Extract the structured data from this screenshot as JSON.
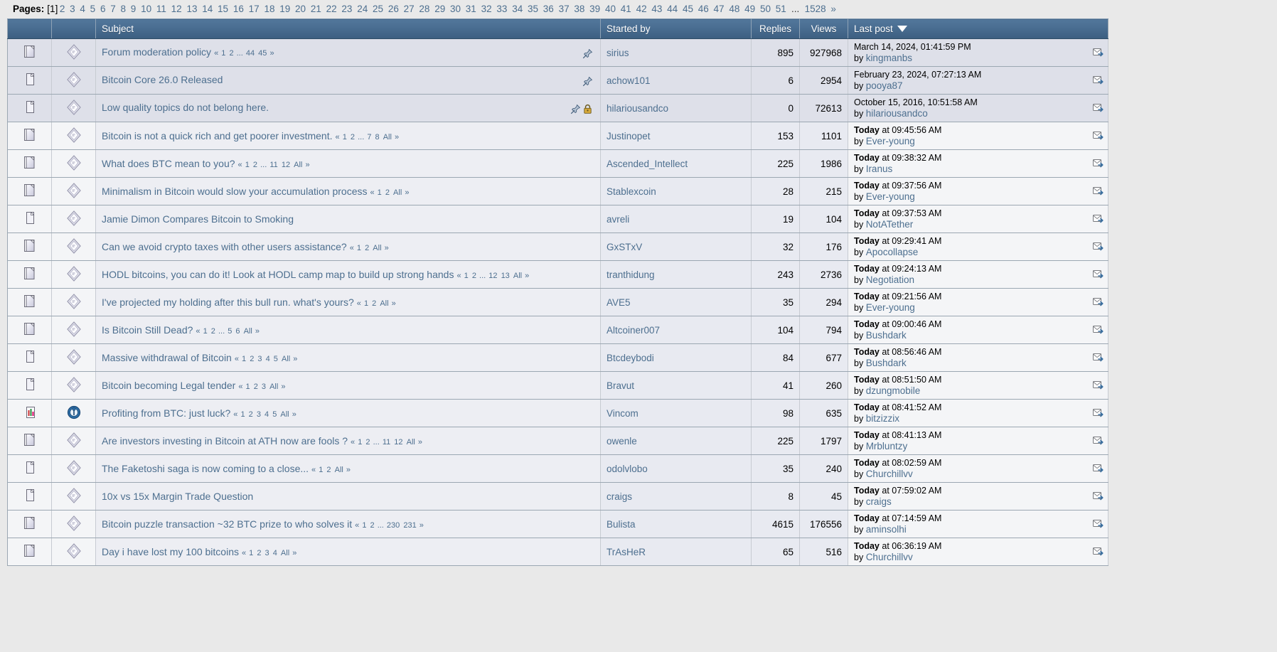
{
  "pagination": {
    "label": "Pages:",
    "current": "1",
    "pages": [
      "2",
      "3",
      "4",
      "5",
      "6",
      "7",
      "8",
      "9",
      "10",
      "11",
      "12",
      "13",
      "14",
      "15",
      "16",
      "17",
      "18",
      "19",
      "20",
      "21",
      "22",
      "23",
      "24",
      "25",
      "26",
      "27",
      "28",
      "29",
      "30",
      "31",
      "32",
      "33",
      "34",
      "35",
      "36",
      "37",
      "38",
      "39",
      "40",
      "41",
      "42",
      "43",
      "44",
      "45",
      "46",
      "47",
      "48",
      "49",
      "50",
      "51"
    ],
    "ellipsis": "...",
    "last": "1528",
    "next": "»"
  },
  "columns": {
    "icon1": "",
    "icon2": "",
    "subject": "Subject",
    "started_by": "Started by",
    "replies": "Replies",
    "views": "Views",
    "last_post": "Last post",
    "sort_indicator": "descending"
  },
  "rows": [
    {
      "state": "sticky",
      "icon1": "pages-stack-icon",
      "icon2": "topic-hot-icon",
      "subject": "Forum moderation policy",
      "pages": [
        "1",
        "2",
        "...",
        "44",
        "45"
      ],
      "has_all": false,
      "pinned": true,
      "locked": false,
      "started_by": "sirius",
      "replies": "895",
      "views": "927968",
      "last_post_date": "March 14, 2024, 01:41:59 PM",
      "last_post_today": false,
      "last_post_by": "kingmanbs"
    },
    {
      "state": "sticky",
      "icon1": "page-single-icon",
      "icon2": "topic-hot-icon",
      "subject": "Bitcoin Core 26.0 Released",
      "pages": [],
      "has_all": false,
      "pinned": true,
      "locked": false,
      "started_by": "achow101",
      "replies": "6",
      "views": "2954",
      "last_post_date": "February 23, 2024, 07:27:13 AM",
      "last_post_today": false,
      "last_post_by": "pooya87"
    },
    {
      "state": "sticky",
      "icon1": "page-single-icon",
      "icon2": "topic-hot-icon",
      "subject": "Low quality topics do not belong here.",
      "pages": [],
      "has_all": false,
      "pinned": true,
      "locked": true,
      "started_by": "hilariousandco",
      "replies": "0",
      "views": "72613",
      "last_post_date": "October 15, 2016, 10:51:58 AM",
      "last_post_today": false,
      "last_post_by": "hilariousandco"
    },
    {
      "state": "normal",
      "icon1": "pages-stack-icon",
      "icon2": "topic-hot-icon",
      "subject": "Bitcoin is not a quick rich and get poorer investment.",
      "pages": [
        "1",
        "2",
        "...",
        "7",
        "8"
      ],
      "has_all": true,
      "pinned": false,
      "locked": false,
      "started_by": "Justinopet",
      "replies": "153",
      "views": "1101",
      "last_post_date": "at 09:45:56 AM",
      "last_post_today": true,
      "last_post_by": "Ever-young"
    },
    {
      "state": "normal",
      "icon1": "pages-stack-icon",
      "icon2": "topic-hot-icon",
      "subject": "What does BTC mean to you?",
      "pages": [
        "1",
        "2",
        "...",
        "11",
        "12"
      ],
      "has_all": true,
      "pinned": false,
      "locked": false,
      "started_by": "Ascended_Intellect",
      "replies": "225",
      "views": "1986",
      "last_post_date": "at 09:38:32 AM",
      "last_post_today": true,
      "last_post_by": "Iranus"
    },
    {
      "state": "normal",
      "icon1": "pages-stack-icon",
      "icon2": "topic-hot-icon",
      "subject": "Minimalism in Bitcoin would slow your accumulation process",
      "pages": [
        "1",
        "2"
      ],
      "has_all": true,
      "pinned": false,
      "locked": false,
      "started_by": "Stablexcoin",
      "replies": "28",
      "views": "215",
      "last_post_date": "at 09:37:56 AM",
      "last_post_today": true,
      "last_post_by": "Ever-young"
    },
    {
      "state": "normal",
      "icon1": "page-single-icon",
      "icon2": "topic-hot-icon",
      "subject": "Jamie Dimon Compares Bitcoin to Smoking",
      "pages": [],
      "has_all": false,
      "pinned": false,
      "locked": false,
      "started_by": "avreli",
      "replies": "19",
      "views": "104",
      "last_post_date": "at 09:37:53 AM",
      "last_post_today": true,
      "last_post_by": "NotATether"
    },
    {
      "state": "normal",
      "icon1": "pages-stack-icon",
      "icon2": "topic-hot-icon",
      "subject": "Can we avoid crypto taxes with other users assistance?",
      "pages": [
        "1",
        "2"
      ],
      "has_all": true,
      "pinned": false,
      "locked": false,
      "started_by": "GxSTxV",
      "replies": "32",
      "views": "176",
      "last_post_date": "at 09:29:41 AM",
      "last_post_today": true,
      "last_post_by": "Apocollapse"
    },
    {
      "state": "normal",
      "icon1": "pages-stack-icon",
      "icon2": "topic-hot-icon",
      "subject": "HODL bitcoins, you can do it! Look at HODL camp map to build up strong hands",
      "pages": [
        "1",
        "2",
        "...",
        "12",
        "13"
      ],
      "has_all": true,
      "pinned": false,
      "locked": false,
      "started_by": "tranthidung",
      "replies": "243",
      "views": "2736",
      "last_post_date": "at 09:24:13 AM",
      "last_post_today": true,
      "last_post_by": "Negotiation"
    },
    {
      "state": "normal",
      "icon1": "pages-stack-icon",
      "icon2": "topic-hot-icon",
      "subject": "I've projected my holding after this bull run. what's yours?",
      "pages": [
        "1",
        "2"
      ],
      "has_all": true,
      "pinned": false,
      "locked": false,
      "started_by": "AVE5",
      "replies": "35",
      "views": "294",
      "last_post_date": "at 09:21:56 AM",
      "last_post_today": true,
      "last_post_by": "Ever-young"
    },
    {
      "state": "normal",
      "icon1": "pages-stack-icon",
      "icon2": "topic-hot-icon",
      "subject": "Is Bitcoin Still Dead?",
      "pages": [
        "1",
        "2",
        "...",
        "5",
        "6"
      ],
      "has_all": true,
      "pinned": false,
      "locked": false,
      "started_by": "Altcoiner007",
      "replies": "104",
      "views": "794",
      "last_post_date": "at 09:00:46 AM",
      "last_post_today": true,
      "last_post_by": "Bushdark"
    },
    {
      "state": "normal",
      "icon1": "page-single-icon",
      "icon2": "topic-hot-icon",
      "subject": "Massive withdrawal of Bitcoin",
      "pages": [
        "1",
        "2",
        "3",
        "4",
        "5"
      ],
      "has_all": true,
      "pinned": false,
      "locked": false,
      "started_by": "Btcdeybodi",
      "replies": "84",
      "views": "677",
      "last_post_date": "at 08:56:46 AM",
      "last_post_today": true,
      "last_post_by": "Bushdark"
    },
    {
      "state": "normal",
      "icon1": "page-single-icon",
      "icon2": "topic-hot-icon",
      "subject": "Bitcoin becoming Legal tender",
      "pages": [
        "1",
        "2",
        "3"
      ],
      "has_all": true,
      "pinned": false,
      "locked": false,
      "started_by": "Bravut",
      "replies": "41",
      "views": "260",
      "last_post_date": "at 08:51:50 AM",
      "last_post_today": true,
      "last_post_by": "dzungmobile"
    },
    {
      "state": "normal",
      "icon1": "poll-bars-icon",
      "icon2": "poll-icon",
      "subject": "Profiting from BTC: just luck?",
      "pages": [
        "1",
        "2",
        "3",
        "4",
        "5"
      ],
      "has_all": true,
      "pinned": false,
      "locked": false,
      "started_by": "Vincom",
      "replies": "98",
      "views": "635",
      "last_post_date": "at 08:41:52 AM",
      "last_post_today": true,
      "last_post_by": "bitzizzix"
    },
    {
      "state": "normal",
      "icon1": "pages-stack-icon",
      "icon2": "topic-hot-icon",
      "subject": "Are investors investing in Bitcoin at ATH now are fools ?",
      "pages": [
        "1",
        "2",
        "...",
        "11",
        "12"
      ],
      "has_all": true,
      "pinned": false,
      "locked": false,
      "started_by": "owenle",
      "replies": "225",
      "views": "1797",
      "last_post_date": "at 08:41:13 AM",
      "last_post_today": true,
      "last_post_by": "Mrbluntzy"
    },
    {
      "state": "normal",
      "icon1": "page-single-icon",
      "icon2": "topic-hot-icon",
      "subject": "The Faketoshi saga is now coming to a close...",
      "pages": [
        "1",
        "2"
      ],
      "has_all": true,
      "pinned": false,
      "locked": false,
      "started_by": "odolvlobo",
      "replies": "35",
      "views": "240",
      "last_post_date": "at 08:02:59 AM",
      "last_post_today": true,
      "last_post_by": "Churchillvv"
    },
    {
      "state": "normal",
      "icon1": "page-single-icon",
      "icon2": "topic-hot-icon",
      "subject": "10x vs 15x Margin Trade Question",
      "pages": [],
      "has_all": false,
      "pinned": false,
      "locked": false,
      "started_by": "craigs",
      "replies": "8",
      "views": "45",
      "last_post_date": "at 07:59:02 AM",
      "last_post_today": true,
      "last_post_by": "craigs"
    },
    {
      "state": "normal",
      "icon1": "pages-stack-icon",
      "icon2": "topic-hot-icon",
      "subject": "Bitcoin puzzle transaction ~32 BTC prize to who solves it",
      "pages": [
        "1",
        "2",
        "...",
        "230",
        "231"
      ],
      "has_all": false,
      "pinned": false,
      "locked": false,
      "started_by": "Bulista",
      "replies": "4615",
      "views": "176556",
      "last_post_date": "at 07:14:59 AM",
      "last_post_today": true,
      "last_post_by": "aminsolhi"
    },
    {
      "state": "normal",
      "icon1": "pages-stack-icon",
      "icon2": "topic-hot-icon",
      "subject": "Day i have lost my 100 bitcoins",
      "pages": [
        "1",
        "2",
        "3",
        "4"
      ],
      "has_all": true,
      "pinned": false,
      "locked": false,
      "started_by": "TrAsHeR",
      "replies": "65",
      "views": "516",
      "last_post_date": "at 06:36:19 AM",
      "last_post_today": true,
      "last_post_by": "Churchillvv"
    }
  ],
  "labels": {
    "today": "Today",
    "by": "by",
    "all": "All",
    "open_bracket": "«",
    "close_bracket": "»",
    "ellipsis": "..."
  },
  "colors": {
    "header_start": "#52779B",
    "header_end": "#3C5E80",
    "link": "#4D6F8F",
    "sticky_row_bg": "#DEE0E9",
    "normal_row_bg": "#F4F5F7",
    "page_bg": "#E9E9E9"
  }
}
